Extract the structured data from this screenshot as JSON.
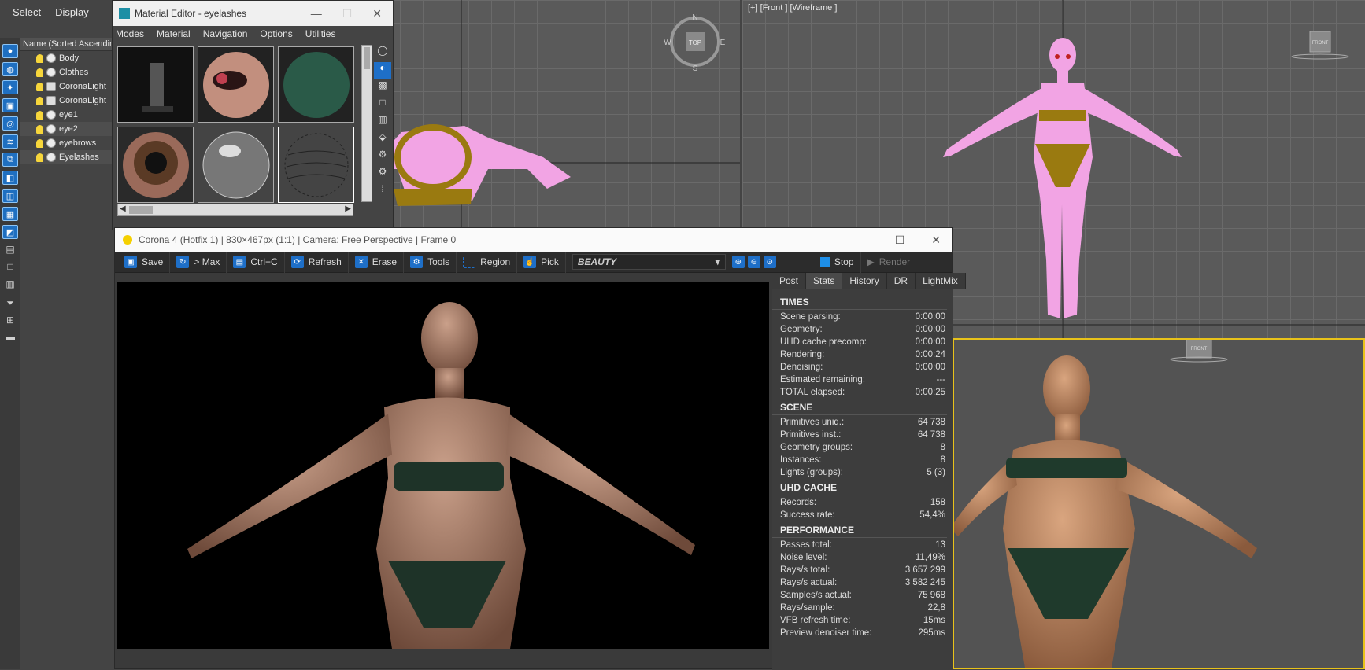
{
  "top_menu": {
    "select": "Select",
    "display": "Display"
  },
  "scene_explorer": {
    "header": "Name (Sorted Ascending",
    "items": [
      {
        "label": "Body",
        "type": "object"
      },
      {
        "label": "Clothes",
        "type": "object"
      },
      {
        "label": "CoronaLight",
        "type": "light"
      },
      {
        "label": "CoronaLight",
        "type": "light"
      },
      {
        "label": "eye1",
        "type": "object"
      },
      {
        "label": "eye2",
        "type": "object",
        "selected": true
      },
      {
        "label": "eyebrows",
        "type": "object"
      },
      {
        "label": "Eyelashes",
        "type": "object",
        "selected": true
      }
    ]
  },
  "material_editor": {
    "title": "Material Editor - eyelashes",
    "menu": [
      "Modes",
      "Material",
      "Navigation",
      "Options",
      "Utilities"
    ]
  },
  "viewports": {
    "front_label": "[+] [Front ] [Wireframe ]",
    "compass": {
      "n": "N",
      "s": "S",
      "e": "E",
      "w": "W",
      "top": "TOP"
    },
    "viewcube_front": "FRONT"
  },
  "vfb": {
    "title": "Corona 4 (Hotfix 1) | 830×467px (1:1) | Camera: Free Perspective | Frame 0",
    "toolbar": {
      "save": "Save",
      "to_max": "> Max",
      "copy": "Ctrl+C",
      "refresh": "Refresh",
      "erase": "Erase",
      "tools": "Tools",
      "region": "Region",
      "pick": "Pick",
      "channel": "BEAUTY",
      "stop": "Stop",
      "render": "Render"
    },
    "tabs": [
      "Post",
      "Stats",
      "History",
      "DR",
      "LightMix"
    ],
    "active_tab": "Stats",
    "stats": {
      "times": {
        "title": "TIMES",
        "rows": [
          {
            "label": "Scene parsing:",
            "value": "0:00:00"
          },
          {
            "label": "Geometry:",
            "value": "0:00:00"
          },
          {
            "label": "UHD cache precomp:",
            "value": "0:00:00"
          },
          {
            "label": "Rendering:",
            "value": "0:00:24"
          },
          {
            "label": "Denoising:",
            "value": "0:00:00"
          },
          {
            "label": "Estimated remaining:",
            "value": "---"
          },
          {
            "label": "TOTAL elapsed:",
            "value": "0:00:25"
          }
        ]
      },
      "scene": {
        "title": "SCENE",
        "rows": [
          {
            "label": "Primitives uniq.:",
            "value": "64 738"
          },
          {
            "label": "Primitives inst.:",
            "value": "64 738"
          },
          {
            "label": "Geometry groups:",
            "value": "8"
          },
          {
            "label": "Instances:",
            "value": "8"
          },
          {
            "label": "Lights (groups):",
            "value": "5 (3)"
          }
        ]
      },
      "uhd": {
        "title": "UHD CACHE",
        "rows": [
          {
            "label": "Records:",
            "value": "158"
          },
          {
            "label": "Success rate:",
            "value": "54,4%"
          }
        ]
      },
      "performance": {
        "title": "PERFORMANCE",
        "rows": [
          {
            "label": "Passes total:",
            "value": "13"
          },
          {
            "label": "Noise level:",
            "value": "11,49%"
          },
          {
            "label": "Rays/s total:",
            "value": "3 657 299"
          },
          {
            "label": "Rays/s actual:",
            "value": "3 582 245"
          },
          {
            "label": "Samples/s actual:",
            "value": "75 968"
          },
          {
            "label": "Rays/sample:",
            "value": "22,8"
          },
          {
            "label": "VFB refresh time:",
            "value": "15ms"
          },
          {
            "label": "Preview denoiser time:",
            "value": "295ms"
          }
        ]
      }
    }
  },
  "colors": {
    "accent_blue": "#1e6fc8",
    "wire_pink": "#f0a0e0",
    "wire_gold": "#9a7a10",
    "active_viewport": "#e8c21a"
  }
}
